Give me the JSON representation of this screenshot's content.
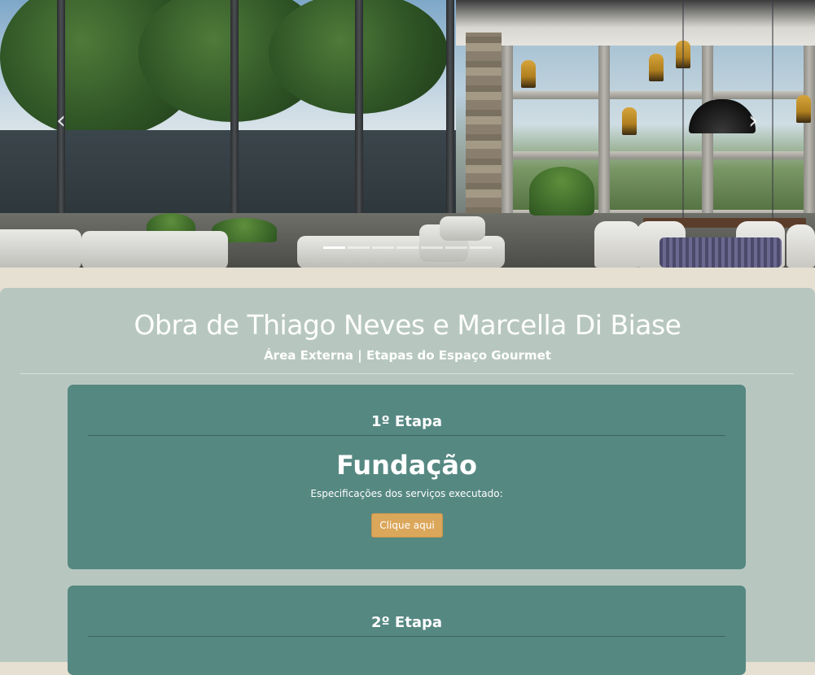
{
  "carousel": {
    "prev_icon": "‹",
    "next_icon": "›",
    "slide_count": 7,
    "active_index": 0
  },
  "obra": {
    "title": "Obra de Thiago Neves e Marcella Di Biase",
    "subtitle": "Área Externa | Etapas do Espaço Gourmet"
  },
  "stages": [
    {
      "label": "1º Etapa",
      "name": "Fundação",
      "description": "Especificações dos serviços executado:",
      "button_label": "Clique aqui"
    },
    {
      "label": "2º Etapa"
    }
  ],
  "colors": {
    "page_background": "#e6e0d2",
    "panel": "#b7c7bf",
    "card": "#568882",
    "button": "#dba75a",
    "text": "#ffffff"
  }
}
